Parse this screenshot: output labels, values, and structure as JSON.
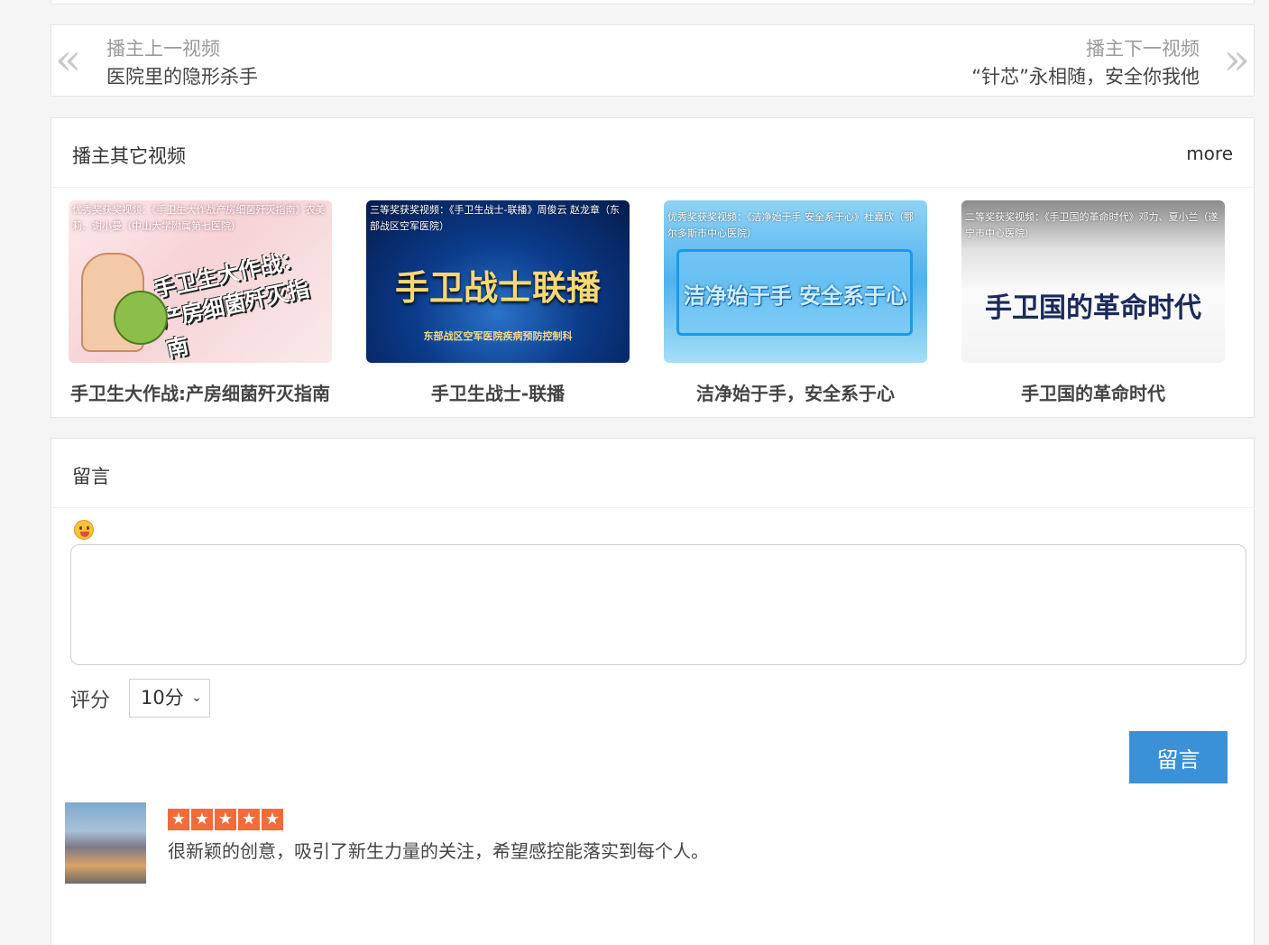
{
  "pager": {
    "prev_hint": "播主上一视频",
    "prev_title": "医院里的隐形杀手",
    "next_hint": "播主下一视频",
    "next_title": "“针芯”永相随，安全你我他",
    "left_arrow": "«",
    "right_arrow": "»"
  },
  "others": {
    "title": "播主其它视频",
    "more": "more",
    "videos": [
      {
        "caption": "优秀奖获奖视频：《手卫生大作战产房细菌歼灭指南》农美莉、谢小曼（中山大学附属第七医院）",
        "thumb_text": "手卫生大作战：产房细菌歼灭指南",
        "title": "手卫生大作战:产房细菌歼灭指南"
      },
      {
        "caption": "三等奖获奖视频：《手卫生战士-联播》周俊云 赵龙章（东部战区空军医院）",
        "thumb_text": "手卫战士联播",
        "thumb_sub": "东部战区空军医院疾病预防控制科",
        "title": "手卫生战士-联播"
      },
      {
        "caption": "优秀奖获奖视频：《洁净始于手 安全系于心》杜嘉欣（鄂尔多斯市中心医院）",
        "thumb_text": "洁净始于手 安全系于心",
        "title": "洁净始于手，安全系于心"
      },
      {
        "caption": "二等奖获奖视频：《手卫国的革命时代》邓力、夏小兰（遂宁市中心医院）",
        "thumb_text": "手卫国的革命时代",
        "title": "手卫国的革命时代"
      }
    ]
  },
  "comments": {
    "title": "留言",
    "score_label": "评分",
    "score_value": "10分",
    "submit_label": "留言",
    "items": [
      {
        "rating": 5,
        "text": "很新颖的创意，吸引了新生力量的关注，希望感控能落实到每个人。"
      }
    ]
  },
  "colors": {
    "accent": "#3a91d8",
    "star": "#f26c3b"
  }
}
